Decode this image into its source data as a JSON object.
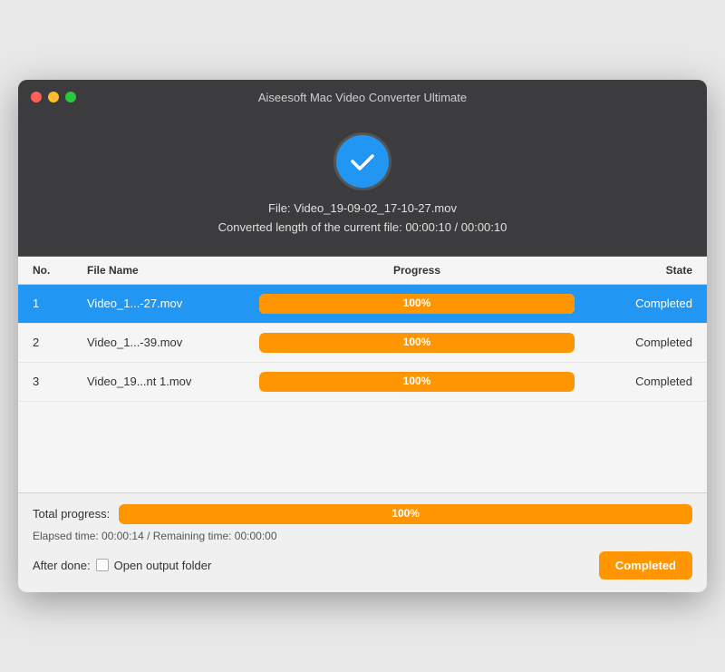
{
  "window": {
    "title": "Aiseesoft Mac Video Converter Ultimate"
  },
  "header": {
    "file_info_line1": "File: Video_19-09-02_17-10-27.mov",
    "file_info_line2": "Converted length of the current file: 00:00:10 / 00:00:10"
  },
  "table": {
    "columns": {
      "no": "No.",
      "filename": "File Name",
      "progress": "Progress",
      "state": "State"
    },
    "rows": [
      {
        "no": "1",
        "filename": "Video_1...-27.mov",
        "progress": "100%",
        "progress_pct": 100,
        "state": "Completed",
        "selected": true
      },
      {
        "no": "2",
        "filename": "Video_1...-39.mov",
        "progress": "100%",
        "progress_pct": 100,
        "state": "Completed",
        "selected": false
      },
      {
        "no": "3",
        "filename": "Video_19...nt 1.mov",
        "progress": "100%",
        "progress_pct": 100,
        "state": "Completed",
        "selected": false
      }
    ]
  },
  "footer": {
    "total_progress_label": "Total progress:",
    "total_progress_pct": "100%",
    "elapsed_time": "Elapsed time: 00:00:14 / Remaining time: 00:00:00",
    "after_done_label": "After done:",
    "open_folder_label": "Open output folder",
    "completed_button_label": "Completed"
  }
}
